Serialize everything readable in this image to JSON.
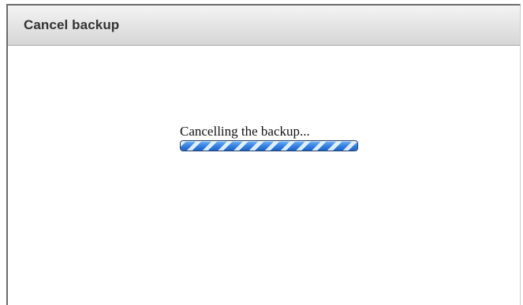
{
  "dialog": {
    "title": "Cancel backup",
    "status_text": "Cancelling the backup...",
    "progress": {
      "state": "indeterminate"
    }
  },
  "colors": {
    "progress_blue": "#3a86e6",
    "progress_border": "#1f3f6e",
    "titlebar_gray": "#e0e0e0",
    "title_text": "#333333"
  }
}
